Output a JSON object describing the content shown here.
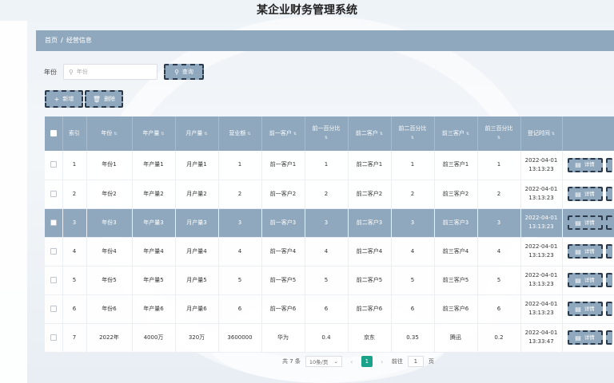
{
  "app": {
    "title": "某企业财务管理系统"
  },
  "breadcrumb": {
    "home": "首页",
    "separator": "/",
    "current": "经营信息"
  },
  "search": {
    "label": "年份",
    "placeholder": "年份",
    "query_button": "查询"
  },
  "actions": {
    "add": "新增",
    "delete": "删除"
  },
  "table": {
    "headers": [
      "索引",
      "年份",
      "年产量",
      "月产量",
      "营业额",
      "前一客户",
      "前一百分比",
      "前二客户",
      "前二百分比",
      "前三客户",
      "前三百分比",
      "登记时间"
    ],
    "sort_glyph": "⇅",
    "detail_label": "详情",
    "rows": [
      {
        "idx": "1",
        "year": "年份1",
        "annual": "年产量1",
        "monthly": "月产量1",
        "revenue": "1",
        "c1": "前一客户1",
        "p1": "1",
        "c2": "前二客户1",
        "p2": "1",
        "c3": "前三客户1",
        "p3": "1",
        "date": "2022-04-01",
        "time": "13:13:23"
      },
      {
        "idx": "2",
        "year": "年份2",
        "annual": "年产量2",
        "monthly": "月产量2",
        "revenue": "2",
        "c1": "前一客户2",
        "p1": "2",
        "c2": "前二客户2",
        "p2": "2",
        "c3": "前三客户2",
        "p3": "2",
        "date": "2022-04-01",
        "time": "13:13:23"
      },
      {
        "idx": "3",
        "year": "年份3",
        "annual": "年产量3",
        "monthly": "月产量3",
        "revenue": "3",
        "c1": "前一客户3",
        "p1": "3",
        "c2": "前二客户3",
        "p2": "3",
        "c3": "前三客户3",
        "p3": "3",
        "date": "2022-04-01",
        "time": "13:13:23"
      },
      {
        "idx": "4",
        "year": "年份4",
        "annual": "年产量4",
        "monthly": "月产量4",
        "revenue": "4",
        "c1": "前一客户4",
        "p1": "4",
        "c2": "前二客户4",
        "p2": "4",
        "c3": "前三客户4",
        "p3": "4",
        "date": "2022-04-01",
        "time": "13:13:23"
      },
      {
        "idx": "5",
        "year": "年份5",
        "annual": "年产量5",
        "monthly": "月产量5",
        "revenue": "5",
        "c1": "前一客户5",
        "p1": "5",
        "c2": "前二客户5",
        "p2": "5",
        "c3": "前三客户5",
        "p3": "5",
        "date": "2022-04-01",
        "time": "13:13:23"
      },
      {
        "idx": "6",
        "year": "年份6",
        "annual": "年产量6",
        "monthly": "月产量6",
        "revenue": "6",
        "c1": "前一客户6",
        "p1": "6",
        "c2": "前二客户6",
        "p2": "6",
        "c3": "前三客户6",
        "p3": "6",
        "date": "2022-04-01",
        "time": "13:13:23"
      },
      {
        "idx": "7",
        "year": "2022年",
        "annual": "4000万",
        "monthly": "320万",
        "revenue": "3600000",
        "c1": "华为",
        "p1": "0.4",
        "c2": "京东",
        "p2": "0.35",
        "c3": "腾迅",
        "p3": "0.2",
        "date": "2022-04-01",
        "time": "13:33:47"
      }
    ],
    "highlighted_row_index": 2
  },
  "pagination": {
    "total": "共 7 条",
    "page_size": "10条/页",
    "current_page": "1",
    "goto_label": "前往",
    "goto_value": "1",
    "page_suffix": "页"
  },
  "colors": {
    "accent": "#8fa8bd",
    "active_page": "#1aa38a"
  }
}
